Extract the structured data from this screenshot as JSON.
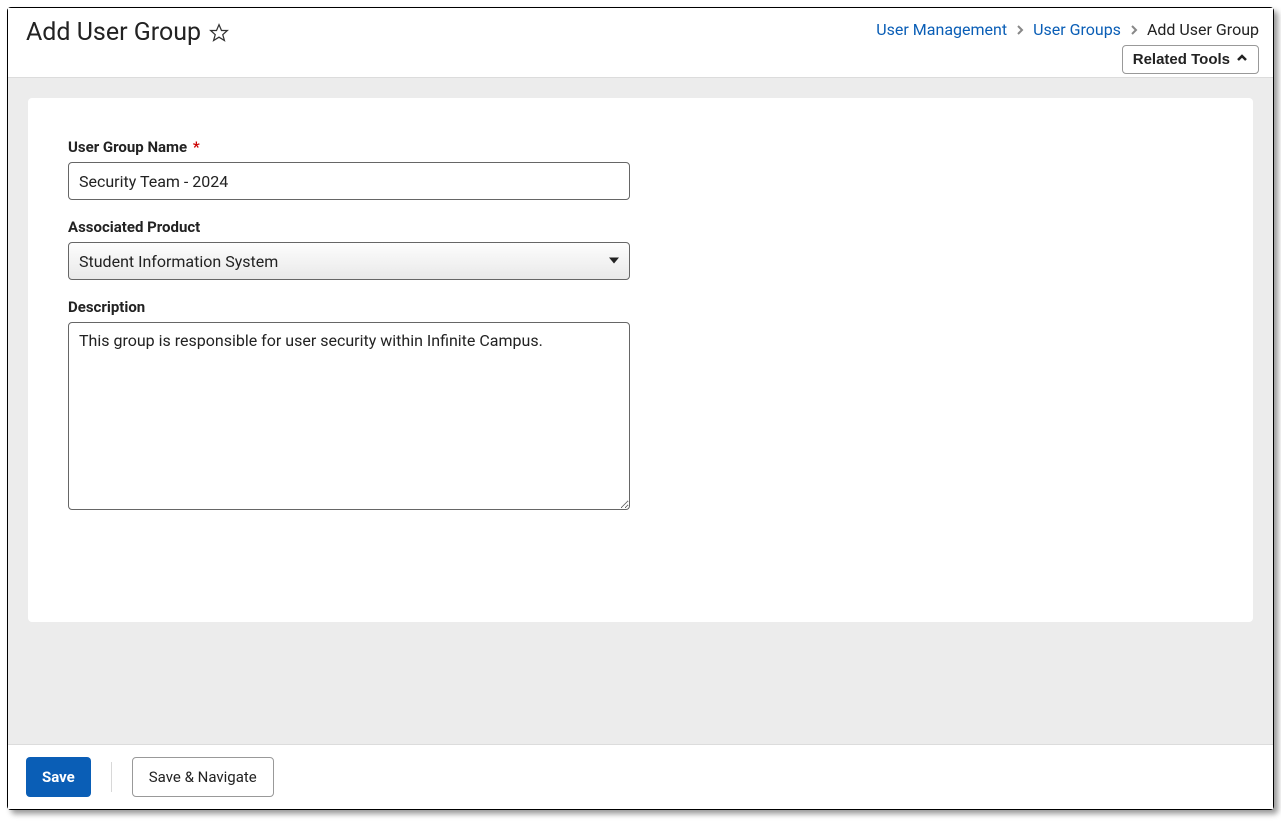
{
  "header": {
    "title": "Add User Group",
    "related_tools_label": "Related Tools"
  },
  "breadcrumb": {
    "items": [
      {
        "label": "User Management",
        "link": true
      },
      {
        "label": "User Groups",
        "link": true
      },
      {
        "label": "Add User Group",
        "link": false
      }
    ]
  },
  "form": {
    "group_name": {
      "label": "User Group Name",
      "required": true,
      "value": "Security Team - 2024"
    },
    "associated_product": {
      "label": "Associated Product",
      "value": "Student Information System"
    },
    "description": {
      "label": "Description",
      "value": "This group is responsible for user security within Infinite Campus."
    }
  },
  "footer": {
    "save_label": "Save",
    "save_navigate_label": "Save & Navigate"
  }
}
